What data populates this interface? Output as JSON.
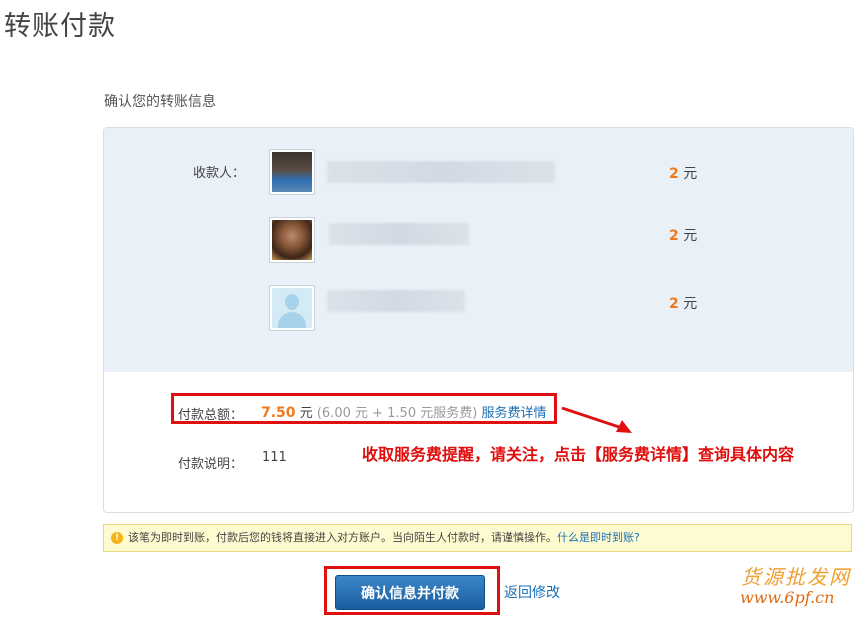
{
  "page": {
    "title": "转账付款"
  },
  "section": {
    "title": "确认您的转账信息"
  },
  "payees": {
    "label": "收款人：",
    "rows": [
      {
        "amount": "2",
        "unit": "元"
      },
      {
        "amount": "2",
        "unit": "元"
      },
      {
        "amount": "2",
        "unit": "元"
      }
    ]
  },
  "total": {
    "label": "付款总额：",
    "amount": "7.50",
    "unit": "元",
    "breakdown": "(6.00 元 + 1.50 元服务费)",
    "fee_link": "服务费详情"
  },
  "annotation": {
    "reminder": "收取服务费提醒，请关注，点击【服务费详情】查询具体内容",
    "color": "#e00d0d"
  },
  "note": {
    "label": "付款说明：",
    "value": "111"
  },
  "notice": {
    "icon": "warning-icon",
    "text": "该笔为即时到账，付款后您的钱将直接进入对方账户。当向陌生人付款时，请谨慎操作。",
    "link": "什么是即时到账?"
  },
  "actions": {
    "confirm_label": "确认信息并付款",
    "back_label": "返回修改"
  },
  "watermark": {
    "line1": "货源批发网",
    "line2": "www.6pf.cn"
  },
  "colors": {
    "accent": "#f0781d",
    "link": "#1a6fb5",
    "button": "#1b5e9e",
    "highlight": "#e01010"
  }
}
